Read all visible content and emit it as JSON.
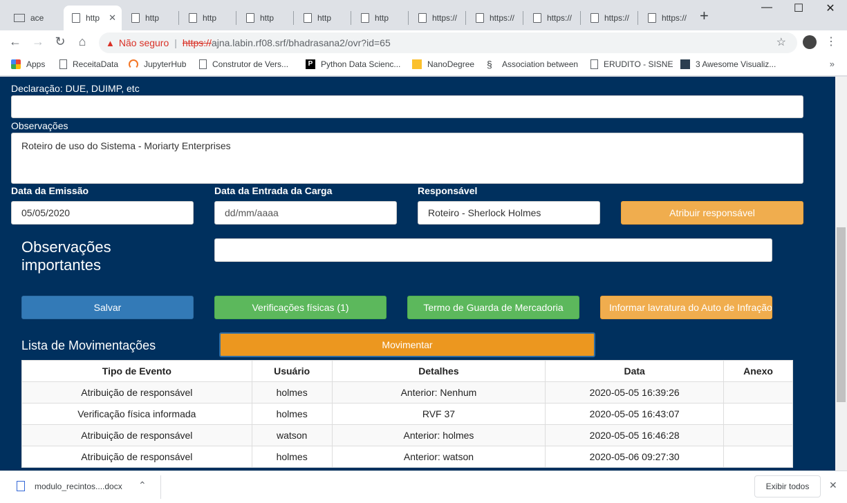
{
  "tabs": [
    {
      "label": "ace",
      "icon": "mail-icon"
    },
    {
      "label": "http",
      "icon": "page-icon"
    },
    {
      "label": "http",
      "icon": "page-icon"
    },
    {
      "label": "http",
      "icon": "page-icon"
    },
    {
      "label": "http",
      "icon": "page-icon"
    },
    {
      "label": "http",
      "icon": "page-icon"
    },
    {
      "label": "http",
      "icon": "page-icon"
    },
    {
      "label": "https://",
      "icon": "page-icon"
    },
    {
      "label": "https://",
      "icon": "page-icon"
    },
    {
      "label": "https://",
      "icon": "page-icon"
    },
    {
      "label": "https://",
      "icon": "page-icon"
    },
    {
      "label": "https://",
      "icon": "page-icon"
    }
  ],
  "toolbar": {
    "security_label": "Não seguro",
    "url_scheme": "https://",
    "url_rest": "ajna.labin.rf08.srf/bhadrasana2/ovr?id=65"
  },
  "bookmarks": [
    {
      "label": "Apps",
      "color": "#ea4335"
    },
    {
      "label": "ReceitaData",
      "color": "#5f6368"
    },
    {
      "label": "JupyterHub",
      "color": "#f37626"
    },
    {
      "label": "Construtor de Vers...",
      "color": "#5f6368"
    },
    {
      "label": "Python Data Scienc...",
      "color": "#000000"
    },
    {
      "label": "NanoDegree",
      "color": "#fbc02d"
    },
    {
      "label": "Association between",
      "color": "#3c4043"
    },
    {
      "label": "ERUDITO - SISNE",
      "color": "#5f6368"
    },
    {
      "label": "3 Awesome Visualiz...",
      "color": "#2c3e50"
    }
  ],
  "form": {
    "declaracao_label": "Declaração: DUE, DUIMP, etc",
    "declaracao_value": "",
    "observacoes_label": "Observações",
    "observacoes_value": "Roteiro de uso do Sistema - Moriarty Enterprises",
    "data_emissao_label": "Data da Emissão",
    "data_emissao_value": "05/05/2020",
    "data_entrada_label": "Data da Entrada da Carga",
    "data_entrada_placeholder": "dd/mm/aaaa",
    "responsavel_label": "Responsável",
    "responsavel_value": "Roteiro - Sherlock Holmes",
    "atribuir_button": "Atribuir responsável",
    "obs_importantes_line1": "Observações",
    "obs_importantes_line2": "importantes",
    "obs_importantes_value": ""
  },
  "actions": {
    "salvar": "Salvar",
    "verificacoes": "Verificações físicas (1)",
    "termo_guarda": "Termo de Guarda de Mercadoria",
    "informar_auto": "Informar lavratura do Auto de Infração"
  },
  "movimentacoes": {
    "title": "Lista de Movimentações",
    "movimentar_button": "Movimentar",
    "headers": [
      "Tipo de Evento",
      "Usuário",
      "Detalhes",
      "Data",
      "Anexo"
    ],
    "rows": [
      [
        "Atribuição de responsável",
        "holmes",
        "Anterior: Nenhum",
        "2020-05-05 16:39:26",
        ""
      ],
      [
        "Verificação física informada",
        "holmes",
        "RVF 37",
        "2020-05-05 16:43:07",
        ""
      ],
      [
        "Atribuição de responsável",
        "watson",
        "Anterior: holmes",
        "2020-05-05 16:46:28",
        ""
      ],
      [
        "Atribuição de responsável",
        "holmes",
        "Anterior: watson",
        "2020-05-06 09:27:30",
        ""
      ]
    ]
  },
  "download": {
    "filename": "modulo_recintos....docx",
    "show_all": "Exibir todos"
  },
  "colors": {
    "page_bg": "#00305e",
    "orange": "#f0ad4e",
    "blue": "#337ab7",
    "green": "#5cb85c"
  }
}
